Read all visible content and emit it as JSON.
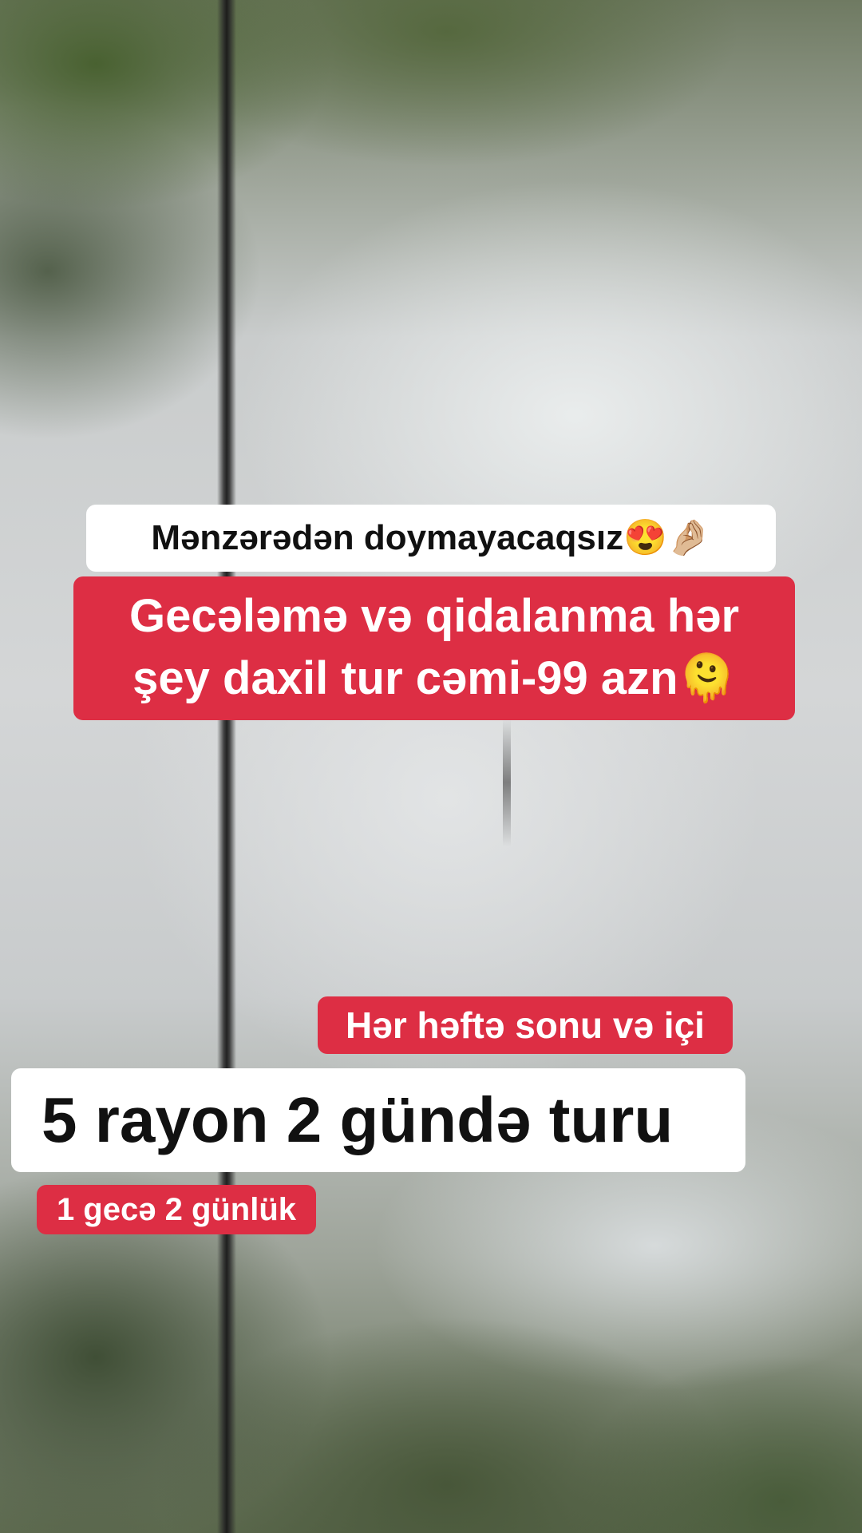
{
  "captions": {
    "scenery": "Mənzərədən doymayacaqsız😍🤌🏼",
    "price_line1": "Gecələmə və qidalanma hər",
    "price_line2": "şey daxil tur cəmi-99 azn🫠",
    "schedule": "Hər həftə sonu və içi",
    "title": "5 rayon 2 gündə turu",
    "duration": "1 gecə 2 günlük"
  },
  "colors": {
    "red_label": "#dd2e44",
    "white_label": "#ffffff",
    "text_dark": "#111111"
  }
}
